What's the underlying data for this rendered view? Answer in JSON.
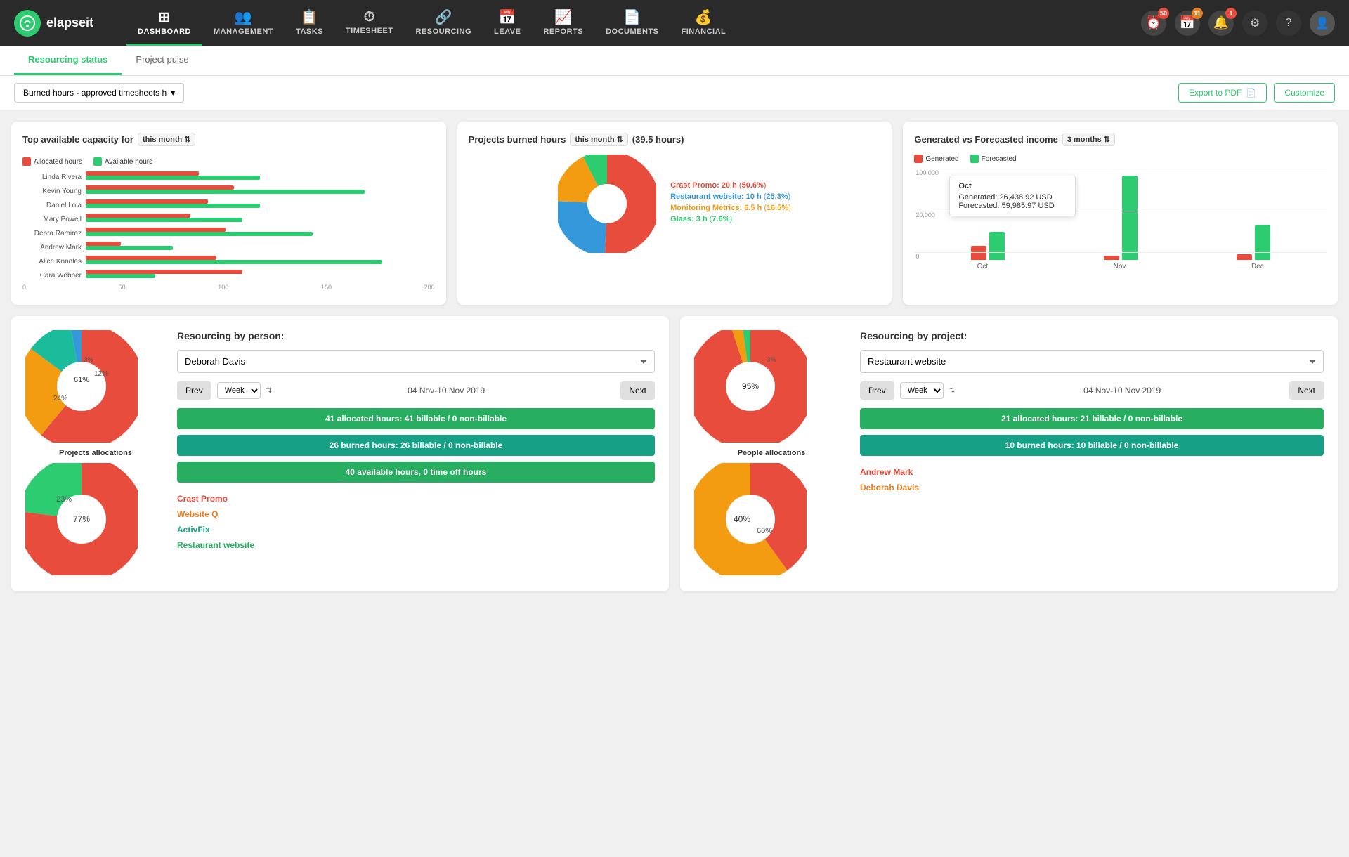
{
  "brand": {
    "name": "elapseit",
    "logo_symbol": "C"
  },
  "nav": {
    "items": [
      {
        "label": "DASHBOARD",
        "icon": "⊞",
        "active": true
      },
      {
        "label": "MANAGEMENT",
        "icon": "👥"
      },
      {
        "label": "TASKS",
        "icon": "📋"
      },
      {
        "label": "TIMESHEET",
        "icon": "⏱"
      },
      {
        "label": "RESOURCING",
        "icon": "🔗"
      },
      {
        "label": "LEAVE",
        "icon": "📅"
      },
      {
        "label": "REPORTS",
        "icon": "📈"
      },
      {
        "label": "DOCUMENTS",
        "icon": "📄"
      },
      {
        "label": "FINANCIAL",
        "icon": "💰"
      }
    ],
    "badges": [
      {
        "icon": "⏰",
        "count": "50",
        "color": "red"
      },
      {
        "icon": "📅",
        "count": "11",
        "color": "orange"
      },
      {
        "icon": "🔔",
        "count": "1",
        "color": "red"
      }
    ]
  },
  "tabs": [
    {
      "label": "Resourcing status",
      "active": true
    },
    {
      "label": "Project pulse",
      "active": false
    }
  ],
  "toolbar": {
    "filter_label": "Burned hours - approved timesheets h",
    "export_label": "Export to PDF",
    "customize_label": "Customize"
  },
  "top_capacity": {
    "title": "Top available capacity for",
    "period": "this month",
    "legend": {
      "allocated": "Allocated hours",
      "available": "Available hours"
    },
    "people": [
      {
        "name": "Linda Rivera",
        "allocated": 65,
        "available": 100,
        "max": 200
      },
      {
        "name": "Kevin Young",
        "allocated": 85,
        "available": 160,
        "max": 200
      },
      {
        "name": "Daniel Lola",
        "allocated": 70,
        "available": 100,
        "max": 200
      },
      {
        "name": "Mary Powell",
        "allocated": 60,
        "available": 90,
        "max": 200
      },
      {
        "name": "Debra Ramirez",
        "allocated": 80,
        "available": 130,
        "max": 200
      },
      {
        "name": "Andrew Mark",
        "allocated": 20,
        "available": 50,
        "max": 200
      },
      {
        "name": "Alice Knnoles",
        "allocated": 75,
        "available": 170,
        "max": 200
      },
      {
        "name": "Cara Webber",
        "allocated": 90,
        "available": 40,
        "max": 200
      }
    ],
    "axis": [
      "0",
      "50",
      "100",
      "150",
      "200"
    ]
  },
  "burned_hours": {
    "title": "Projects burned hours",
    "period": "this month",
    "total": "39.5 hours",
    "projects": [
      {
        "name": "Crast Promo:",
        "hours": "20 h",
        "percent": "50.6%",
        "color": "#e74c3c",
        "pct_num": 50.6
      },
      {
        "name": "Restaurant website:",
        "hours": "10 h",
        "percent": "25.3%",
        "color": "#3498db",
        "pct_num": 25.3
      },
      {
        "name": "Monitoring Metrics:",
        "hours": "6.5 h",
        "percent": "16.5%",
        "color": "#f39c12",
        "pct_num": 16.5
      },
      {
        "name": "Glass:",
        "hours": "3 h",
        "percent": "7.6%",
        "color": "#2ecc71",
        "pct_num": 7.6
      }
    ]
  },
  "income": {
    "title": "Generated vs Forecasted income",
    "period": "3 months",
    "legend": {
      "generated": "Generated",
      "forecasted": "Forecasted"
    },
    "tooltip": {
      "month": "Oct",
      "generated_label": "Generated:",
      "generated_val": "26,438.92 USD",
      "forecasted_label": "Forecasted:",
      "forecasted_val": "59,985.97 USD"
    },
    "months": [
      {
        "label": "Oct",
        "generated_h": 20,
        "forecasted_h": 40
      },
      {
        "label": "Nov",
        "generated_h": 5,
        "forecasted_h": 120
      },
      {
        "label": "Dec",
        "generated_h": 8,
        "forecasted_h": 50
      }
    ],
    "y_labels": [
      "100,000",
      "20,000",
      "0"
    ]
  },
  "resourcing_person": {
    "title": "Resourcing by person:",
    "person": "Deborah Davis",
    "prev_label": "Prev",
    "next_label": "Next",
    "week_label": "Week",
    "date_range": "04 Nov-10 Nov 2019",
    "stats": [
      {
        "text": "41 allocated hours: 41 billable / 0 non-billable",
        "type": "green"
      },
      {
        "text": "26 burned hours: 26 billable / 0 non-billable",
        "type": "teal"
      },
      {
        "text": "40 available hours, 0 time off hours",
        "type": "green"
      }
    ],
    "projects": [
      {
        "name": "Crast Promo",
        "color": "red"
      },
      {
        "name": "Website Q",
        "color": "orange"
      },
      {
        "name": "ActivFix",
        "color": "teal"
      },
      {
        "name": "Restaurant website",
        "color": "green"
      }
    ],
    "pie1": {
      "label": "Projects allocations",
      "segments": [
        {
          "color": "#e74c3c",
          "pct": 61,
          "label": "61%"
        },
        {
          "color": "#f39c12",
          "pct": 24,
          "label": "24%"
        },
        {
          "color": "#1abc9c",
          "pct": 12,
          "label": "12%"
        },
        {
          "color": "#3498db",
          "pct": 3,
          "label": "3%"
        }
      ]
    },
    "pie2": {
      "label": "",
      "segments": [
        {
          "color": "#e74c3c",
          "pct": 77,
          "label": "77%"
        },
        {
          "color": "#2ecc71",
          "pct": 23,
          "label": "23%"
        }
      ]
    }
  },
  "resourcing_project": {
    "title": "Resourcing by project:",
    "project": "Restaurant website",
    "prev_label": "Prev",
    "next_label": "Next",
    "week_label": "Week",
    "date_range": "04 Nov-10 Nov 2019",
    "stats": [
      {
        "text": "21 allocated hours: 21 billable / 0 non-billable",
        "type": "green"
      },
      {
        "text": "10 burned hours: 10 billable / 0 non-billable",
        "type": "teal"
      }
    ],
    "people": [
      {
        "name": "Andrew Mark",
        "color": "red"
      },
      {
        "name": "Deborah Davis",
        "color": "orange"
      }
    ],
    "pie1": {
      "label": "People allocations",
      "segments": [
        {
          "color": "#e74c3c",
          "pct": 95,
          "label": "95%"
        },
        {
          "color": "#f39c12",
          "pct": 3,
          "label": "3%"
        },
        {
          "color": "#2ecc71",
          "pct": 2,
          "label": "2%"
        }
      ]
    },
    "pie2": {
      "label": "",
      "segments": [
        {
          "color": "#e74c3c",
          "pct": 40,
          "label": "40%"
        },
        {
          "color": "#f39c12",
          "pct": 60,
          "label": "60%"
        }
      ]
    }
  }
}
